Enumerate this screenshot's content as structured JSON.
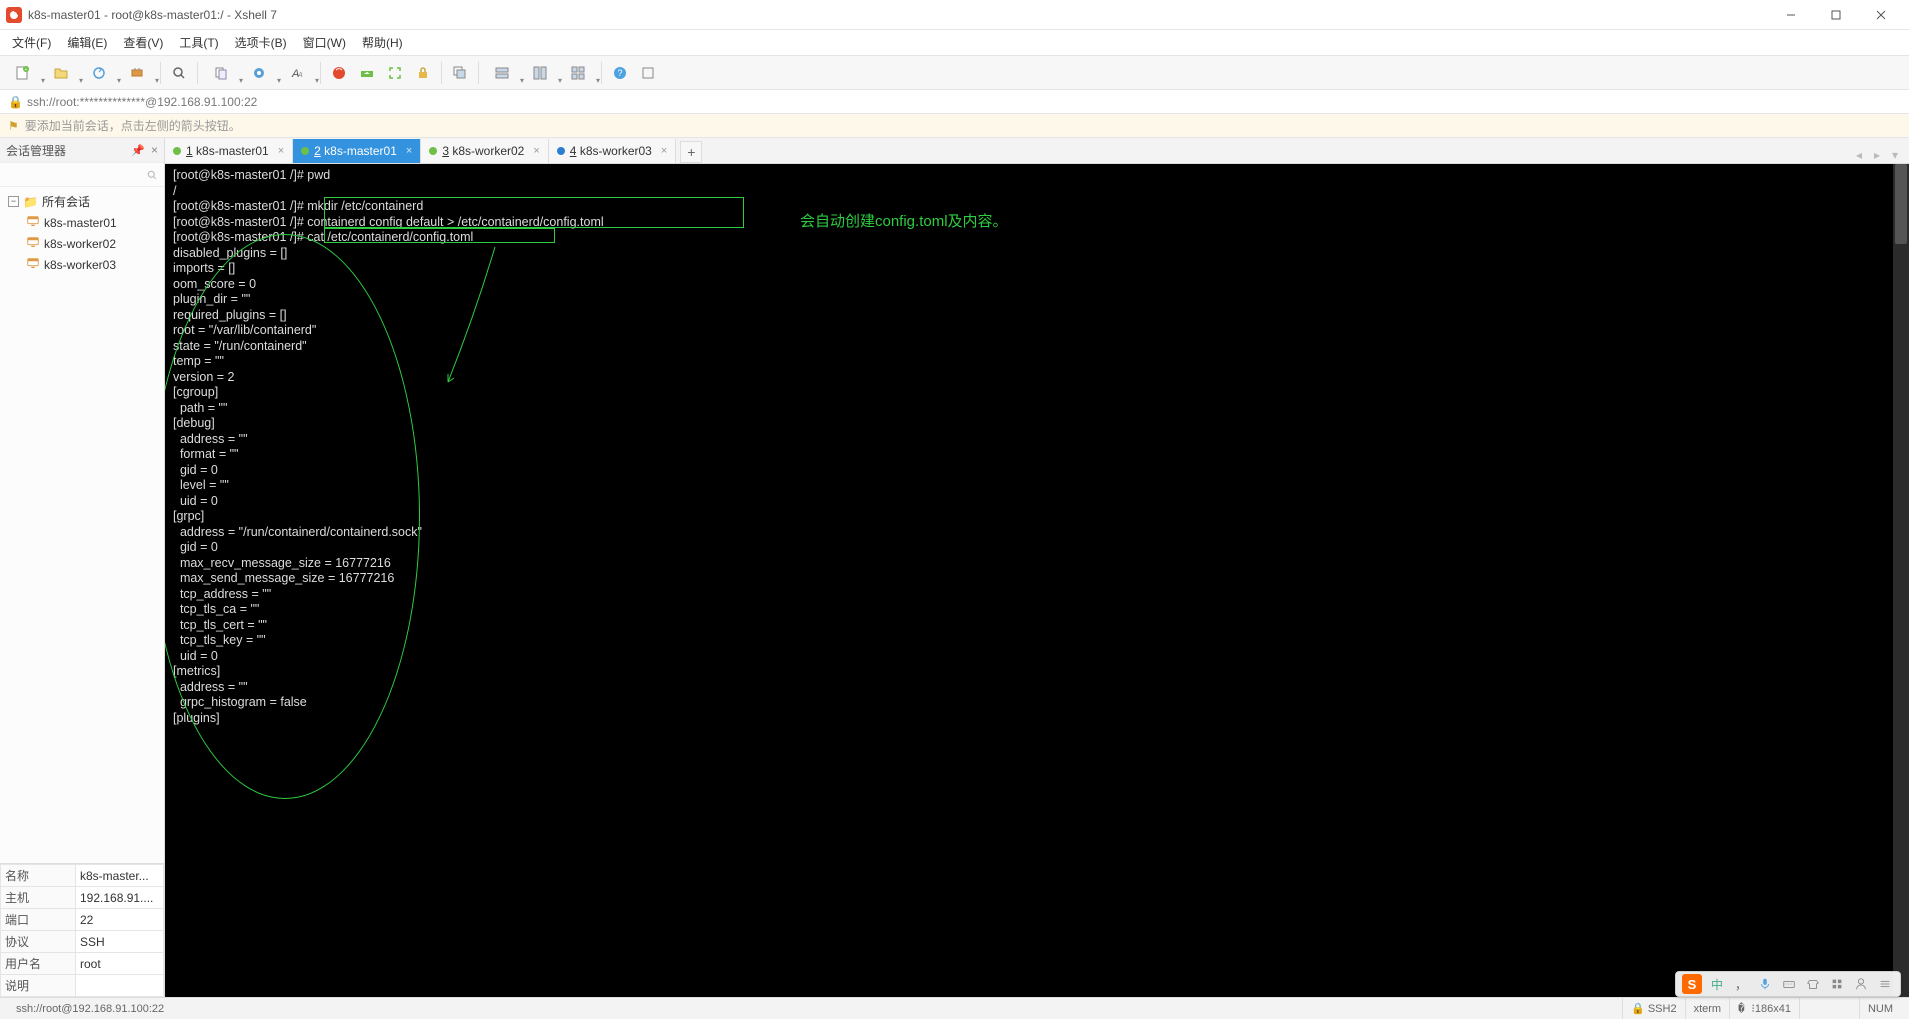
{
  "window": {
    "title": "k8s-master01 - root@k8s-master01:/ - Xshell 7"
  },
  "menu": {
    "file": "文件(F)",
    "edit": "编辑(E)",
    "view": "查看(V)",
    "tools": "工具(T)",
    "tabs": "选项卡(B)",
    "window": "窗口(W)",
    "help": "帮助(H)"
  },
  "addressbar": {
    "url": "ssh://root:**************@192.168.91.100:22"
  },
  "infobar": {
    "text": "要添加当前会话，点击左侧的箭头按钮。"
  },
  "tabs": [
    {
      "num": "1",
      "label": "k8s-master01",
      "dot": "g",
      "active": false
    },
    {
      "num": "2",
      "label": "k8s-master01",
      "dot": "g",
      "active": true
    },
    {
      "num": "3",
      "label": "k8s-worker02",
      "dot": "g",
      "active": false
    },
    {
      "num": "4",
      "label": "k8s-worker03",
      "dot": "b",
      "active": false
    }
  ],
  "panel": {
    "title": "会话管理器",
    "root": "所有会话",
    "hosts": [
      "k8s-master01",
      "k8s-worker02",
      "k8s-worker03"
    ]
  },
  "props": {
    "name_k": "名称",
    "name_v": "k8s-master...",
    "host_k": "主机",
    "host_v": "192.168.91....",
    "port_k": "端口",
    "port_v": "22",
    "proto_k": "协议",
    "proto_v": "SSH",
    "user_k": "用户名",
    "user_v": "root",
    "desc_k": "说明",
    "desc_v": ""
  },
  "terminal_lines": [
    "[root@k8s-master01 /]# pwd",
    "/",
    "[root@k8s-master01 /]# mkdir /etc/containerd",
    "[root@k8s-master01 /]# containerd config default > /etc/containerd/config.toml",
    "[root@k8s-master01 /]# cat /etc/containerd/config.toml",
    "disabled_plugins = []",
    "imports = []",
    "oom_score = 0",
    "plugin_dir = \"\"",
    "required_plugins = []",
    "root = \"/var/lib/containerd\"",
    "state = \"/run/containerd\"",
    "temp = \"\"",
    "version = 2",
    "",
    "[cgroup]",
    "  path = \"\"",
    "",
    "[debug]",
    "  address = \"\"",
    "  format = \"\"",
    "  gid = 0",
    "  level = \"\"",
    "  uid = 0",
    "",
    "[grpc]",
    "  address = \"/run/containerd/containerd.sock\"",
    "  gid = 0",
    "  max_recv_message_size = 16777216",
    "  max_send_message_size = 16777216",
    "  tcp_address = \"\"",
    "  tcp_tls_ca = \"\"",
    "  tcp_tls_cert = \"\"",
    "  tcp_tls_key = \"\"",
    "  uid = 0",
    "",
    "[metrics]",
    "  address = \"\"",
    "  grpc_histogram = false",
    "",
    "[plugins]"
  ],
  "annotate": {
    "note": "会自动创建config.toml及内容。"
  },
  "status": {
    "left": "ssh://root@192.168.91.100:22",
    "ssh": "SSH2",
    "term": "xterm",
    "size": "186x41",
    "other1": "",
    "num": "NUM"
  },
  "ime": {
    "logo": "S",
    "lang": "中",
    "punc": "，",
    "full": "•"
  }
}
